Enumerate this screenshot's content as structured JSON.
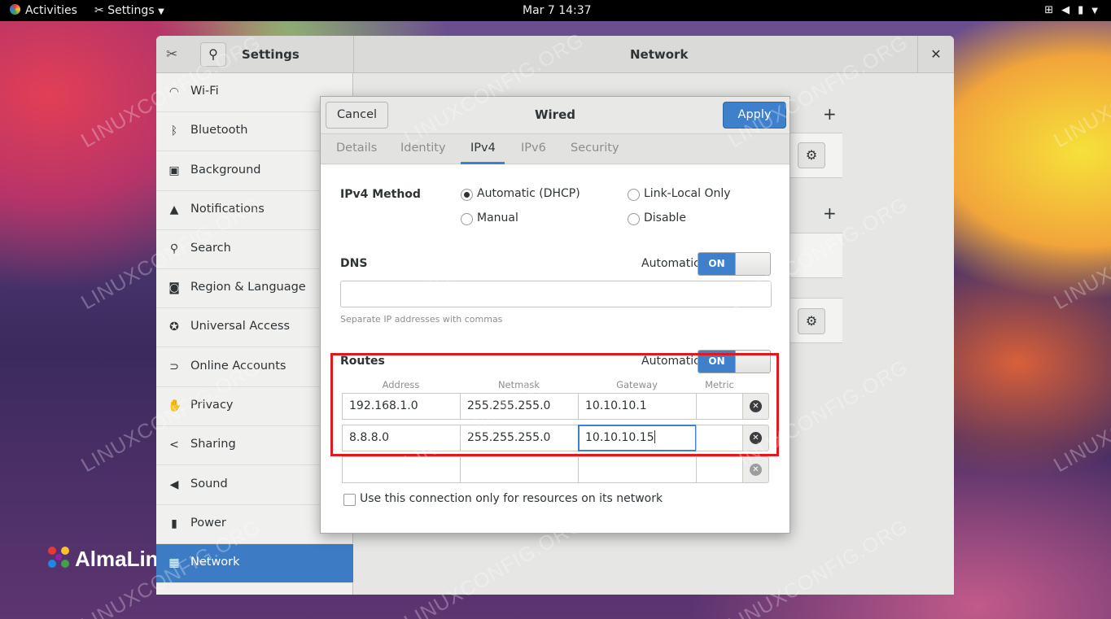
{
  "topbar": {
    "activities": "Activities",
    "app_menu": "Settings",
    "clock": "Mar 7  14:37"
  },
  "settings": {
    "title": "Settings",
    "panel_title": "Network",
    "sidebar": [
      {
        "label": "Wi-Fi",
        "icon": "wifi-icon",
        "glyph": "◠"
      },
      {
        "label": "Bluetooth",
        "icon": "bluetooth-icon",
        "glyph": "ᛒ"
      },
      {
        "label": "Background",
        "icon": "background-icon",
        "glyph": "▣"
      },
      {
        "label": "Notifications",
        "icon": "bell-icon",
        "glyph": "▲"
      },
      {
        "label": "Search",
        "icon": "search-icon",
        "glyph": "⚲"
      },
      {
        "label": "Region & Language",
        "icon": "camera-icon",
        "glyph": "◙"
      },
      {
        "label": "Universal Access",
        "icon": "accessibility-icon",
        "glyph": "✪"
      },
      {
        "label": "Online Accounts",
        "icon": "online-accounts-icon",
        "glyph": "⊃"
      },
      {
        "label": "Privacy",
        "icon": "privacy-hand-icon",
        "glyph": "✋"
      },
      {
        "label": "Sharing",
        "icon": "share-icon",
        "glyph": "<"
      },
      {
        "label": "Sound",
        "icon": "speaker-icon",
        "glyph": "◀"
      },
      {
        "label": "Power",
        "icon": "power-icon",
        "glyph": "▮"
      },
      {
        "label": "Network",
        "icon": "network-icon",
        "glyph": "▦"
      }
    ]
  },
  "dialog": {
    "cancel": "Cancel",
    "title": "Wired",
    "apply": "Apply",
    "tabs": [
      "Details",
      "Identity",
      "IPv4",
      "IPv6",
      "Security"
    ],
    "active_tab": "IPv4",
    "ipv4_method_label": "IPv4 Method",
    "methods": {
      "dhcp": "Automatic (DHCP)",
      "link_local": "Link-Local Only",
      "manual": "Manual",
      "disable": "Disable"
    },
    "selected_method": "Automatic (DHCP)",
    "dns": {
      "label": "DNS",
      "automatic_label": "Automatic",
      "toggle": "ON",
      "value": "",
      "hint": "Separate IP addresses with commas"
    },
    "routes": {
      "label": "Routes",
      "automatic_label": "Automatic",
      "toggle": "ON",
      "columns": [
        "Address",
        "Netmask",
        "Gateway",
        "Metric"
      ],
      "rows": [
        {
          "address": "192.168.1.0",
          "netmask": "255.255.255.0",
          "gateway": "10.10.10.1",
          "metric": ""
        },
        {
          "address": "8.8.8.0",
          "netmask": "255.255.255.0",
          "gateway": "10.10.10.15",
          "metric": ""
        },
        {
          "address": "",
          "netmask": "",
          "gateway": "",
          "metric": ""
        }
      ]
    },
    "only_local_label": "Use this connection only for resources on its network",
    "only_local_checked": false
  },
  "desktop": {
    "logo_text": "AlmaLin",
    "watermark": "LINUXCONFIG.ORG"
  },
  "colors": {
    "accent": "#3e80cc",
    "highlight": "#e0191f"
  }
}
